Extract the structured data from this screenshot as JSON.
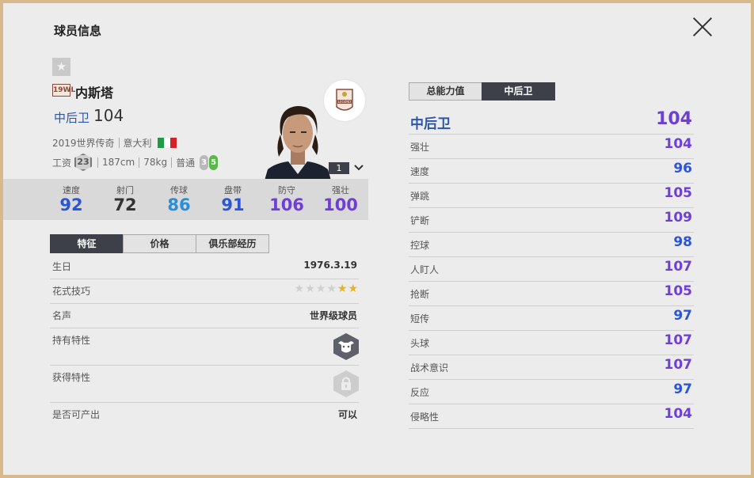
{
  "window": {
    "title": "球员信息",
    "close_label": "关闭"
  },
  "player": {
    "favorite_icon": "★",
    "season_badge": "19WL",
    "name": "内斯塔",
    "position": "中后卫",
    "position_ovr": "104",
    "season": "2019世界传奇",
    "nationality": "意大利",
    "flag_colors": [
      "#1f9b47",
      "#ffffff",
      "#d2232a"
    ],
    "salary_label": "工资",
    "salary": "23",
    "height": "187cm",
    "weight": "78kg",
    "body_type": "普通",
    "weak_foot": "3",
    "strong_foot": "5",
    "rank": "1",
    "emblem_text": "LEGEND"
  },
  "key_stats": [
    {
      "label": "速度",
      "value": "92",
      "color": "#2c55d6"
    },
    {
      "label": "射门",
      "value": "72",
      "color": "#333333"
    },
    {
      "label": "传球",
      "value": "86",
      "color": "#2a8fd6"
    },
    {
      "label": "盘带",
      "value": "91",
      "color": "#2c55d6"
    },
    {
      "label": "防守",
      "value": "106",
      "color": "#6e3fd6"
    },
    {
      "label": "强壮",
      "value": "100",
      "color": "#6e3fd6"
    }
  ],
  "detail_tabs": [
    "特征",
    "价格",
    "俱乐部经历"
  ],
  "details": {
    "birthday_label": "生日",
    "birthday": "1976.3.19",
    "skill_label": "花式技巧",
    "skill_stars": 2,
    "skill_stars_max": 6,
    "reputation_label": "名声",
    "reputation": "世界级球员",
    "traits_label": "持有特性",
    "traits_icon": "buffalo-icon",
    "acquire_label": "获得特性",
    "acquire_icon": "lock-icon",
    "producible_label": "是否可产出",
    "producible": "可以"
  },
  "attr_tabs": [
    "总能力值",
    "中后卫"
  ],
  "attr_header": {
    "label": "中后卫",
    "value": "104"
  },
  "attributes": [
    {
      "label": "强壮",
      "value": "104",
      "color": "#6e3fd6"
    },
    {
      "label": "速度",
      "value": "96",
      "color": "#2c55d6"
    },
    {
      "label": "弹跳",
      "value": "105",
      "color": "#6e3fd6"
    },
    {
      "label": "铲断",
      "value": "109",
      "color": "#6e3fd6"
    },
    {
      "label": "控球",
      "value": "98",
      "color": "#2c55d6"
    },
    {
      "label": "人盯人",
      "value": "107",
      "color": "#6e3fd6"
    },
    {
      "label": "抢断",
      "value": "105",
      "color": "#6e3fd6"
    },
    {
      "label": "短传",
      "value": "97",
      "color": "#2c55d6"
    },
    {
      "label": "头球",
      "value": "107",
      "color": "#6e3fd6"
    },
    {
      "label": "战术意识",
      "value": "107",
      "color": "#6e3fd6"
    },
    {
      "label": "反应",
      "value": "97",
      "color": "#2c55d6"
    },
    {
      "label": "侵略性",
      "value": "104",
      "color": "#6e3fd6"
    }
  ]
}
